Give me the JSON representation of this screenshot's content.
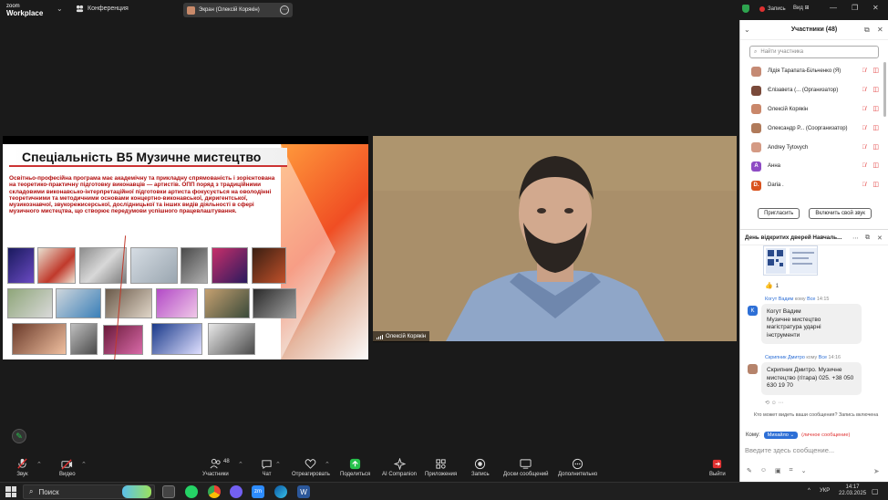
{
  "topbar": {
    "brand_line1": "zoom",
    "brand_line2": "Workplace",
    "conference_label": "Конференция",
    "share_label": "Экран (Олексій Корякін)",
    "record_label": "Запись",
    "view_label": "Вид"
  },
  "slide": {
    "title": "Спеціальність В5 Музичне мистецтво",
    "body": "Освітньо-професійна програма має академічну та прикладну спрямованість і зорієнтована на теоретико-практичну підготовку виконавців — артистів. ОПП поряд з традиційними складовими виконавсько-інтерпретаційної підготовки артиста фокусується на оволодінні теоретичними та методичними основами концертно-виконавської, диригентської, музикознавчої, звукорежисерської, дослідницької та інших видів діяльності в сфері музичного мистецтва, що створює передумови успішного працевлаштування."
  },
  "camera": {
    "name": "Олексій Корякін"
  },
  "toolbar": {
    "audio": "Звук",
    "video": "Видео",
    "participants": "Участники",
    "participants_count": "48",
    "chat": "Чат",
    "react": "Отреагировать",
    "share": "Поделиться",
    "ai": "AI Companion",
    "apps": "Приложения",
    "record": "Запись",
    "whiteboards": "Доски сообщений",
    "more": "Дополнительно",
    "leave": "Выйти"
  },
  "participants": {
    "title": "Участники (48)",
    "search_placeholder": "Найти участника",
    "items": [
      {
        "name": "Лідія Тарапата-Більченко (Я)",
        "color": "#c58a74"
      },
      {
        "name": "Єлізавета (... (Организатор)",
        "color": "#7a4a3a"
      },
      {
        "name": "Олексій Корякін",
        "color": "#c9876a"
      },
      {
        "name": "Олександр Р... (Соорганизатор)",
        "color": "#b07a5a"
      },
      {
        "name": "Andrey Tytovych",
        "color": "#d49a84"
      },
      {
        "name": "Анна",
        "color": "#8e4bc4",
        "initial": "А"
      },
      {
        "name": "Daria .",
        "color": "#d9531e",
        "initial": "D."
      }
    ],
    "invite_button": "Пригласить",
    "unmute_button": "Включить свой звук"
  },
  "chat": {
    "title": "День відкритих дверей Навчаль...",
    "reaction_count": "1",
    "messages": [
      {
        "sender": "Когут Вадим",
        "to": "кому",
        "to_name": "Все",
        "time": "14:15",
        "avatar": "K",
        "text": "Когут Вадим\nМузичне мистецтво\nмагістратура ударні\nінструменти"
      },
      {
        "sender": "Скрипник Дмитро",
        "to": "кому",
        "to_name": "Все",
        "time": "14:16",
        "text": "Скрипник Дмитро. Музичне мистецтво (гітара) 025. +38 050 630 19 70"
      }
    ],
    "notice": "Кто может видеть ваши сообщения? Запись включена",
    "to_label": "Кому:",
    "to_value": "Михайло",
    "to_hint": "(личное сообщение)",
    "input_placeholder": "Введите здесь сообщение..."
  },
  "taskbar": {
    "search_label": "Поиск",
    "lang": "УКР",
    "time": "14:17",
    "date": "22.03.2025"
  }
}
